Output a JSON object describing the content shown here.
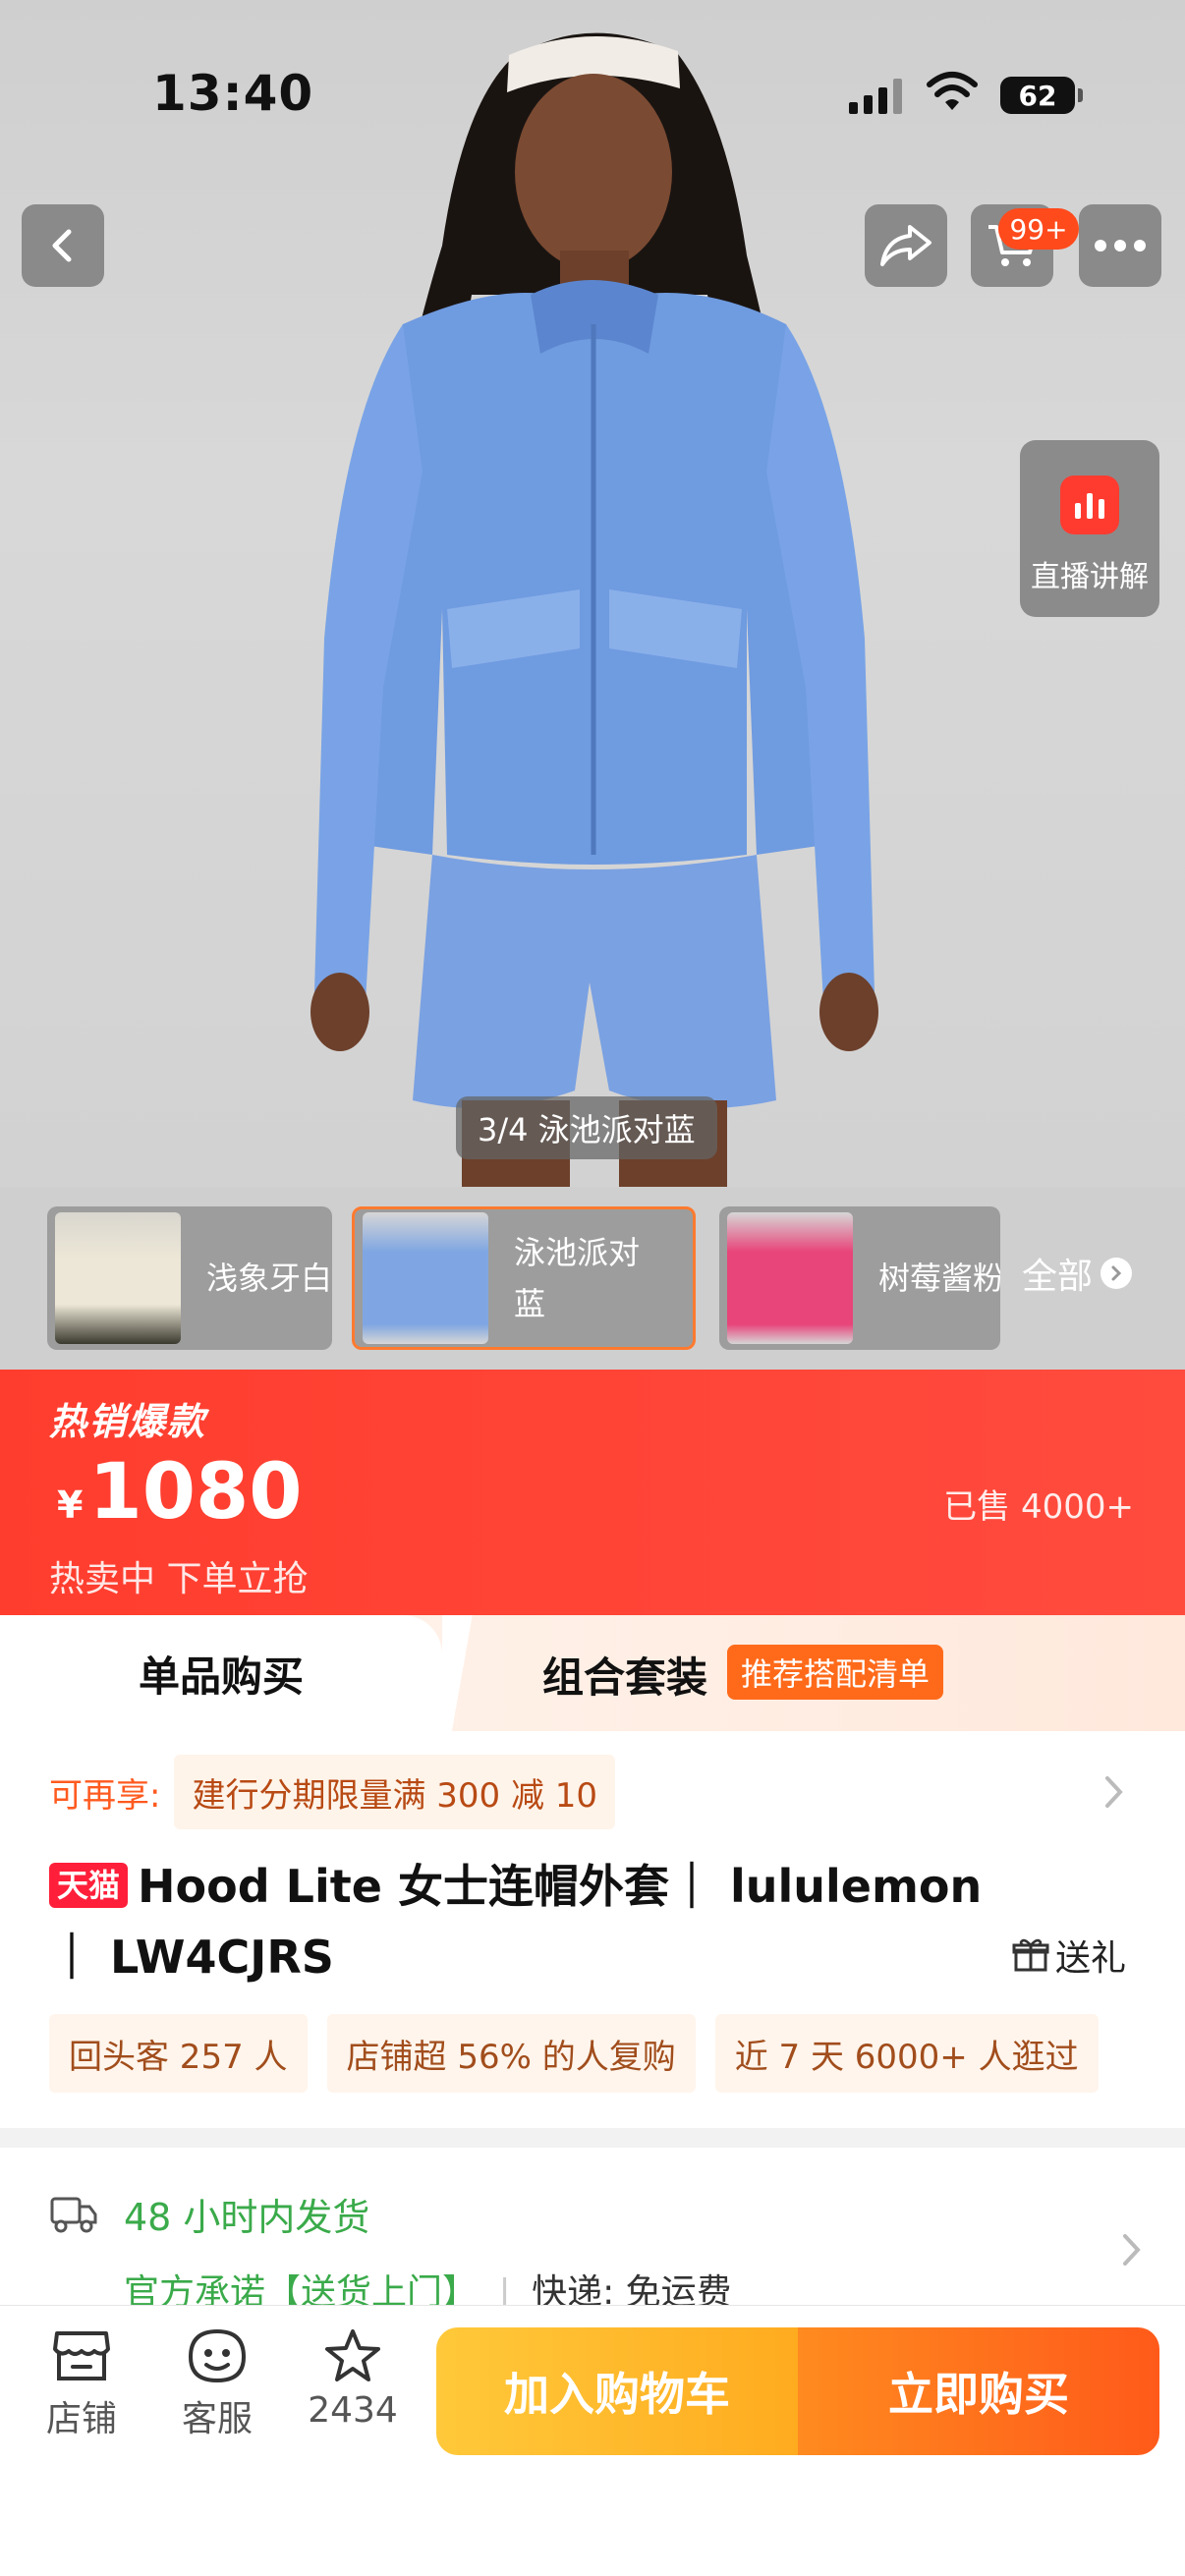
{
  "status_bar": {
    "time": "13:40",
    "battery": "62"
  },
  "header": {
    "cart_badge": "99+"
  },
  "live": {
    "label": "直播讲解"
  },
  "gallery": {
    "counter": "3/4 泳池派对蓝"
  },
  "variants": {
    "items": [
      {
        "name": "浅象牙白",
        "color": "#ece7d6"
      },
      {
        "name": "泳池派对蓝",
        "color": "#7fa6e2",
        "selected": true
      },
      {
        "name": "树莓酱粉",
        "color": "#e8457a"
      }
    ],
    "all_label": "全部"
  },
  "price_banner": {
    "tag": "热销爆款",
    "currency": "¥",
    "price": "1080",
    "sold": "已售 4000+",
    "subtitle": "热卖中 下单立抢"
  },
  "tabs": {
    "single": "单品购买",
    "combo": "组合套装",
    "recommend": "推荐搭配清单"
  },
  "promo": {
    "label": "可再享:",
    "chip": "建行分期限量满 300 减 10"
  },
  "product": {
    "platform_badge": "天猫",
    "title": "Hood Lite 女士连帽外套｜ lululemon ｜ LW4CJRS",
    "gift_label": "送礼"
  },
  "social_chips": [
    "回头客 257 人",
    "店铺超 56% 的人复购",
    "近 7 天 6000+ 人逛过"
  ],
  "shipping": {
    "line1": "48 小时内发货",
    "promise": "官方承诺【送货上门】",
    "separator": "|",
    "delivery": "快递: 免运费"
  },
  "bottom_bar": {
    "store": "店铺",
    "service": "客服",
    "favorites": "2434",
    "add_to_cart": "加入购物车",
    "buy_now": "立即购买"
  },
  "colors": {
    "accent_red": "#ff3d2e",
    "accent_orange": "#ff6a1a",
    "cart_yellow": "#ffc93a",
    "shipping_green": "#3aaa4a"
  }
}
